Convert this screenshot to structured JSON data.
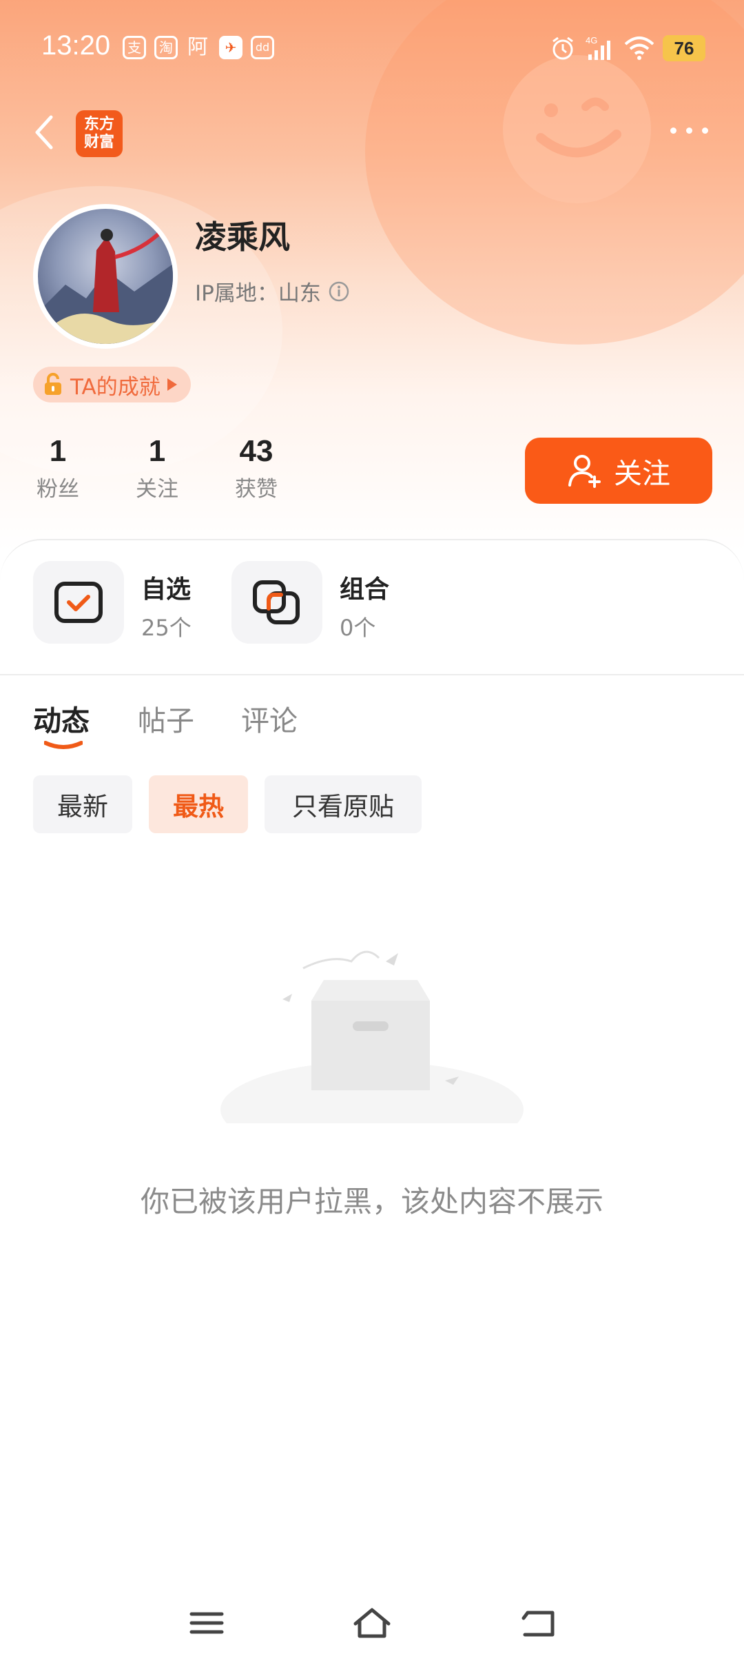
{
  "status_bar": {
    "time": "13:20",
    "app_icons": [
      "支",
      "淘",
      "阿",
      "✈",
      "dd"
    ],
    "network": "4G",
    "battery": "76"
  },
  "nav": {
    "app_logo_line1": "东方",
    "app_logo_line2": "财富"
  },
  "profile": {
    "name": "凌乘风",
    "ip_location": "IP属地：山东",
    "achievement": "TA的成就"
  },
  "stats": [
    {
      "value": "1",
      "label": "粉丝"
    },
    {
      "value": "1",
      "label": "关注"
    },
    {
      "value": "43",
      "label": "获赞"
    }
  ],
  "follow_button": "关注",
  "cards": [
    {
      "title": "自选",
      "count": "25个",
      "icon": "checkbox-icon"
    },
    {
      "title": "组合",
      "count": "0个",
      "icon": "portfolio-icon"
    }
  ],
  "tabs": [
    "动态",
    "帖子",
    "评论"
  ],
  "filters": [
    "最新",
    "最热",
    "只看原贴"
  ],
  "empty_message": "你已被该用户拉黑，该处内容不展示",
  "colors": {
    "accent": "#fa5a17",
    "header_top": "#fba57b",
    "battery": "#f6c44b"
  }
}
